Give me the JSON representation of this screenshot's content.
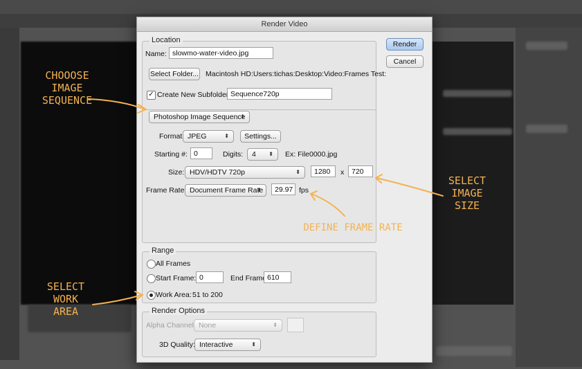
{
  "dialog": {
    "title": "Render Video"
  },
  "location": {
    "legend": "Location",
    "name_label": "Name:",
    "name_value": "slowmo-water-video.jpg",
    "select_folder_label": "Select Folder...",
    "folder_path": "Macintosh HD:Users:tichas:Desktop:Video:Frames Test:",
    "create_subfolder_label": "Create New Subfolder:",
    "create_subfolder_checked": true,
    "subfolder_value": "Sequence720p"
  },
  "buttons": {
    "render": "Render",
    "cancel": "Cancel"
  },
  "export": {
    "type_value": "Photoshop Image Sequence",
    "format_label": "Format:",
    "format_value": "JPEG",
    "settings_label": "Settings...",
    "starting_label": "Starting #:",
    "starting_value": "0",
    "digits_label": "Digits:",
    "digits_value": "4",
    "example": "Ex: File0000.jpg",
    "size_label": "Size:",
    "size_value": "HDV/HDTV 720p",
    "width_value": "1280",
    "x_sep": "x",
    "height_value": "720",
    "frame_rate_label": "Frame Rate:",
    "frame_rate_mode": "Document Frame Rate",
    "fps_value": "29.97",
    "fps_unit": "fps"
  },
  "range": {
    "legend": "Range",
    "all_frames": "All Frames",
    "start_frame_label": "Start Frame:",
    "start_frame_value": "0",
    "end_frame_label": "End Frame:",
    "end_frame_value": "610",
    "work_area_label": "Work Area:",
    "work_area_value": "51 to 200",
    "selected": "work_area"
  },
  "render_options": {
    "legend": "Render Options",
    "alpha_label": "Alpha Channel:",
    "alpha_value": "None",
    "quality_label": "3D Quality:",
    "quality_value": "Interactive"
  },
  "annotations": {
    "choose": "CHOOOSE\nIMAGE\nSEQUENCE",
    "define": "DEFINE FRAME RATE",
    "select_size": "SELECT\nIMAGE\nSIZE",
    "select_work": "SELECT\nWORK\nAREA"
  },
  "colors": {
    "annotation": "#f3b252",
    "default_button": "#aac8ee"
  }
}
